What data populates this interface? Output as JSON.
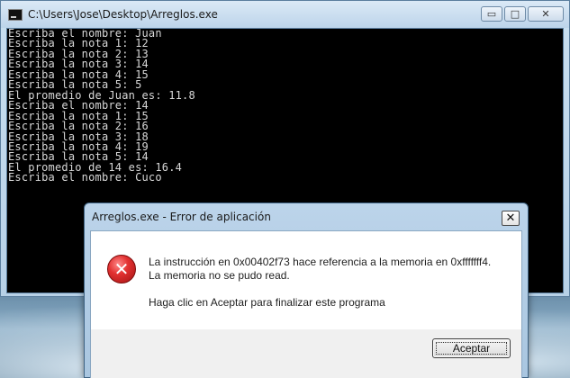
{
  "console": {
    "title": "C:\\Users\\Jose\\Desktop\\Arreglos.exe",
    "minimize_glyph": "▭",
    "maximize_glyph": "□",
    "close_glyph": "✕",
    "lines": [
      "Escriba el nombre: Juan",
      "Escriba la nota 1: 12",
      "Escriba la nota 2: 13",
      "Escriba la nota 3: 14",
      "Escriba la nota 4: 15",
      "Escriba la nota 5: 5",
      "El promedio de Juan es: 11.8",
      "Escriba el nombre: 14",
      "Escriba la nota 1: 15",
      "Escriba la nota 2: 16",
      "Escriba la nota 3: 18",
      "Escriba la nota 4: 19",
      "Escriba la nota 5: 14",
      "El promedio de 14 es: 16.4",
      "Escriba el nombre: Cuco"
    ]
  },
  "dialog": {
    "title": "Arreglos.exe - Error de aplicación",
    "close_glyph": "✕",
    "icon": "error-icon",
    "icon_glyph": "✕",
    "message_line_1": "La instrucción en 0x00402f73 hace referencia a la memoria en 0xfffffff4.",
    "message_line_2": "La memoria no se pudo read.",
    "message_line_3": "Haga clic en Aceptar para finalizar este programa",
    "accept_label": "Aceptar"
  },
  "colors": {
    "console_bg": "#000000",
    "console_text": "#d8d8d8",
    "error_red": "#e23131"
  }
}
